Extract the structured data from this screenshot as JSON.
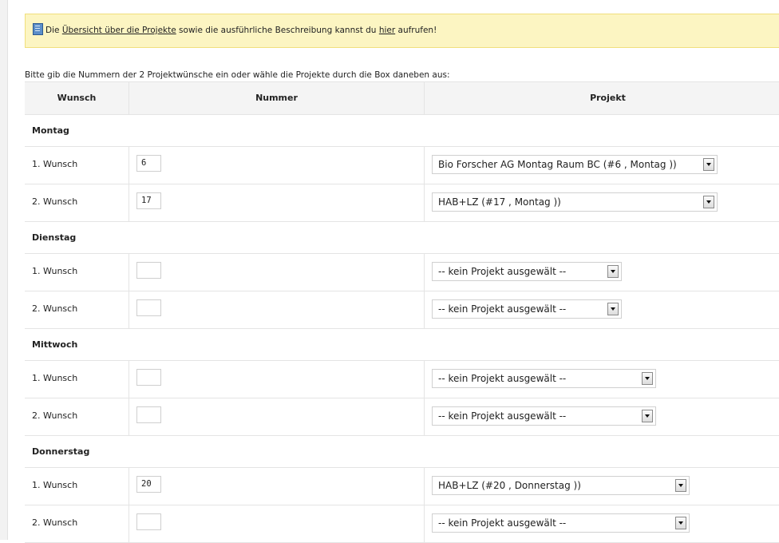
{
  "notice": {
    "prefix": "Die ",
    "link_overview": "Übersicht über die Projekte",
    "middle": " sowie die ausführliche Beschreibung kannst du ",
    "link_here": "hier",
    "suffix": " aufrufen!",
    "icon": "book-icon"
  },
  "intro": "Bitte gib die Nummern der 2 Projektwünsche ein oder wähle die Projekte durch die Box daneben aus:",
  "table": {
    "headers": {
      "wunsch": "Wunsch",
      "nummer": "Nummer",
      "projekt": "Projekt"
    },
    "days": [
      {
        "name": "Montag",
        "rows": [
          {
            "label": "1. Wunsch",
            "number": "6",
            "project": "Bio Forscher AG Montag Raum BC (#6 , Montag ))"
          },
          {
            "label": "2. Wunsch",
            "number": "17",
            "project": "HAB+LZ (#17 , Montag ))"
          }
        ]
      },
      {
        "name": "Dienstag",
        "rows": [
          {
            "label": "1. Wunsch",
            "number": "",
            "project": "-- kein Projekt ausgewält --"
          },
          {
            "label": "2. Wunsch",
            "number": "",
            "project": "-- kein Projekt ausgewält --"
          }
        ]
      },
      {
        "name": "Mittwoch",
        "rows": [
          {
            "label": "1. Wunsch",
            "number": "",
            "project": "-- kein Projekt ausgewält --"
          },
          {
            "label": "2. Wunsch",
            "number": "",
            "project": "-- kein Projekt ausgewält --"
          }
        ]
      },
      {
        "name": "Donnerstag",
        "rows": [
          {
            "label": "1. Wunsch",
            "number": "20",
            "project": "HAB+LZ (#20 , Donnerstag ))"
          },
          {
            "label": "2. Wunsch",
            "number": "",
            "project": "-- kein Projekt ausgewält --"
          }
        ]
      }
    ]
  }
}
